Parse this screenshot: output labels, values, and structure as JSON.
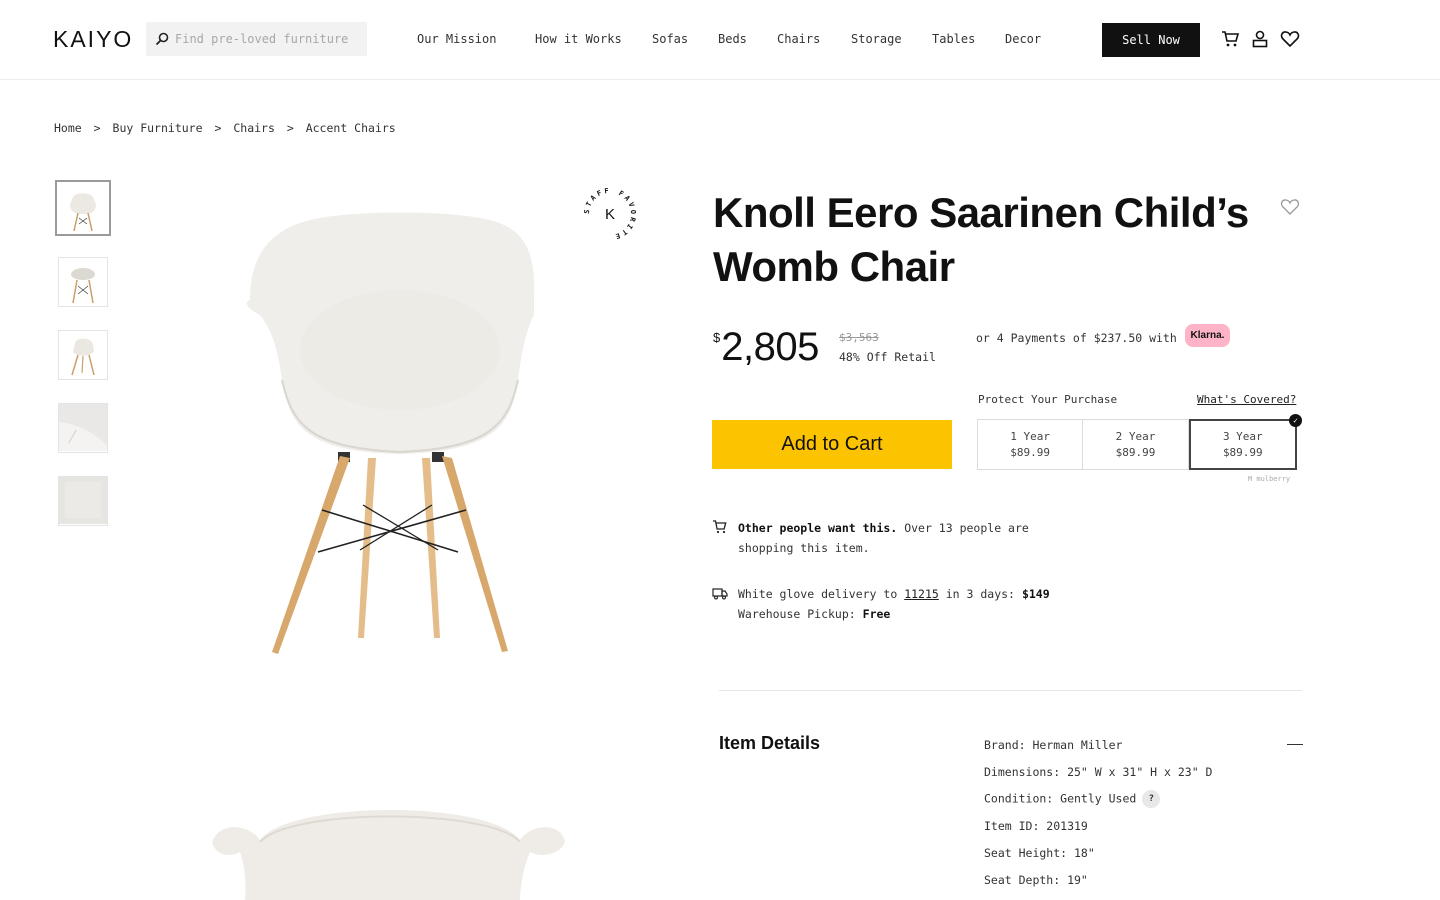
{
  "header": {
    "logo": "KAIYO",
    "search_placeholder": "Find pre-loved furniture",
    "nav": [
      "Our Mission",
      "How it Works",
      "Sofas",
      "Beds",
      "Chairs",
      "Storage",
      "Tables",
      "Decor"
    ],
    "sell_label": "Sell Now",
    "icons": [
      "cart-icon",
      "account-icon",
      "heart-icon"
    ]
  },
  "breadcrumb": [
    "Home",
    ">",
    "Buy Furniture",
    ">",
    "Chairs",
    ">",
    "Accent Chairs"
  ],
  "product": {
    "title": "Knoll Eero Saarinen Child’s Womb Chair",
    "badge_letter": "K",
    "badge_ring": "STAFF FAVORITE",
    "currency": "$",
    "price": "2,805",
    "retail": "$3,563",
    "discount": "48% Off Retail",
    "klarna_text": "or 4 Payments of $237.50 with",
    "klarna_label": "Klarna.",
    "add_to_cart": "Add to Cart"
  },
  "protection": {
    "label": "Protect Your Purchase",
    "link": "What's Covered?",
    "plans": [
      {
        "term": "1 Year",
        "price": "$89.99"
      },
      {
        "term": "2 Year",
        "price": "$89.99"
      },
      {
        "term": "3 Year",
        "price": "$89.99"
      }
    ],
    "selected_index": 2,
    "provider": "M mulberry"
  },
  "demand": {
    "bold": "Other people want this.",
    "text": "Over 13 people are shopping this item."
  },
  "delivery": {
    "prefix": "White glove delivery to",
    "zip": "11215",
    "mid": "in 3 days:",
    "price": "$149",
    "pickup_label": "Warehouse Pickup:",
    "pickup_value": "Free"
  },
  "details": {
    "heading": "Item Details",
    "rows": [
      "Brand: Herman Miller",
      "Dimensions: 25\" W x 31\" H x 23\" D",
      "Condition: Gently Used",
      "Item ID: 201319",
      "Seat Height: 18\"",
      "Seat Depth: 19\""
    ],
    "help_icon": "?"
  },
  "colors": {
    "accent": "#fcc400",
    "klarna": "#ffb3c7",
    "dark": "#111111"
  }
}
